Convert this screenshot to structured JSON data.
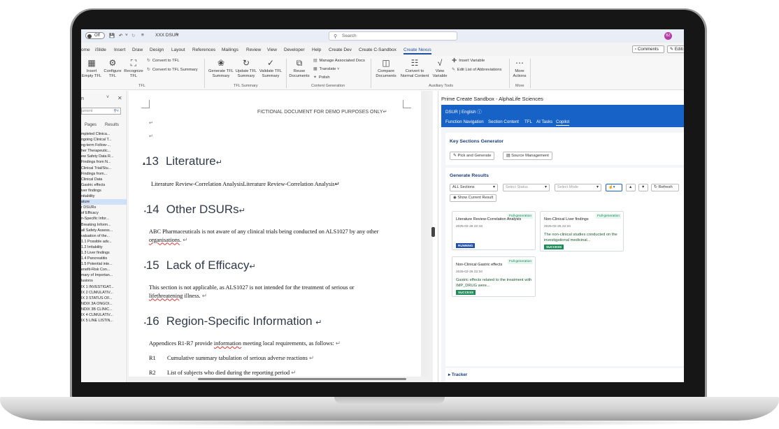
{
  "titlebar": {
    "autosave": "Off",
    "doc_name": "XXX DSUR",
    "search_placeholder": "Search",
    "avatar_initials": "BZ"
  },
  "menubar": {
    "items": [
      "ome",
      "iSlide",
      "Insert",
      "Draw",
      "Design",
      "Layout",
      "References",
      "Mailings",
      "Review",
      "View",
      "Developer",
      "Help",
      "Create Dev",
      "Create C-Sandbox",
      "Create Nexus"
    ],
    "comments": "Comments",
    "editing": "Editi"
  },
  "ribbon": {
    "insert_empty_tfl": "Insert Empty TFL",
    "configure_tfl": "Configure TFL",
    "recognize_tfl": "Recognize TFL",
    "convert_to_tfl": "Convert to TFL",
    "convert_to_tfl_summary": "Convert to TFL Summary",
    "group_tfl": "TFL",
    "generate_tfl_summary": "Generate TFL Summary",
    "update_tfl_summary": "Update TFL Summary",
    "validate_tfl_summary": "Validate TFL Summary",
    "group_tfl_summary": "TFL Summary",
    "reuse_documents": "Reuse Documents",
    "manage_associated_docs": "Manage Associated Docs",
    "translate": "Translate",
    "polish": "Polish",
    "group_content_generation": "Content Generation",
    "compare_documents": "Compare Documents",
    "convert_to_normal_content": "Convert to Normal Content",
    "view_variable": "View Variable",
    "insert_variable": "Insert Variable",
    "edit_list_abbreviations": "Edit List of Abbreviations",
    "group_auxiliary_tools": "Auxiliary Tools",
    "more_actions": "More Actions",
    "group_more": "More"
  },
  "nav": {
    "title": "n",
    "search_placeholder": "ument",
    "tabs": [
      "Pages",
      "Results"
    ],
    "items": [
      "mpleted Clinica...",
      "ngoing Clinical T...",
      "ng-term Follow-...",
      "her Therapeutic...",
      "ew Safety Data R...",
      "Findings from N...",
      "Clinical Trial/Stu...",
      "Findings from...",
      "Clinical Data",
      "Gastric effects",
      "iver findings",
      "nitability",
      "ature",
      "r DSURs",
      "of Efficacy",
      "n-Specific Infor...",
      "Breaking Inform...",
      "all Safety Assess...",
      "valuation of the...",
      "1.1 Possible adv...",
      "1.2 Irritability",
      "1.3 Liver findings",
      "1.4 Pancreatitis",
      "1.5 Potential inte...",
      "enefit-Risk Con...",
      "mary of Importan...",
      "lusions",
      "IX 1 INVESTIGAT...",
      "IX 2 CUMULATIV...",
      "IX 3 STATUS OF...",
      "NDIX 3A ONGOI...",
      "NDIX 3B CLINIC...",
      "IX 4 CUMULATIV...",
      "IX 5 LINE LISTIN..."
    ],
    "selected_index": 12
  },
  "document": {
    "header": "FICTIONAL DOCUMENT FOR DEMO PURPOSES ONLY",
    "para_mark": "↵",
    "s13_num": "13",
    "s13_title": "Literature",
    "s13_body": "Literature Review-Correlation AnalysisLiterature Review-Correlation Analysis",
    "s14_num": "14",
    "s14_title": "Other DSURs",
    "s14_body_a": "ABC Pharmaceuticals  is not aware of any clinical trials being conducted on  ALS1027  by any other ",
    "s14_body_u": "organisations",
    "s14_body_b": ".",
    "s15_num": "15",
    "s15_title": "Lack of Efficacy",
    "s15_body_a": "This section is not applicable, as  ALS1027  is not intended for the treatment of serious or ",
    "s15_body_u": "lifethreatening",
    "s15_body_b": " illness.",
    "s16_num": "16",
    "s16_title": "Region-Specific Information",
    "s16_body_a": "Appendices R1-R7 provide ",
    "s16_body_u": "information",
    "s16_body_b": " meeting local requirements, as follows:",
    "r1_code": "R1",
    "r1_text": "Cumulative summary tabulation of serious adverse reactions",
    "r2_code": "R2",
    "r2_text": "List of subjects who died during the reporting period"
  },
  "panel": {
    "title": "Prime Create Sandbox - AlphaLife Sciences",
    "top": "DSUR | English",
    "tabs": [
      "Function Navigation",
      "Section Content",
      "TFL",
      "AI Tasks",
      "Copilot"
    ],
    "active_tab": "Copilot",
    "key_sections": "Key Sections Generator",
    "pick_generate": "Pick and Generate",
    "source_management": "Source Management",
    "generate_results": "Generate Results",
    "filter_sections": "ALL Sections",
    "filter_status": "Select Status",
    "filter_mode": "Select Mode",
    "refresh": "Refresh",
    "show_current": "Show Current Result",
    "tracker": "Tracker",
    "results": [
      {
        "title": "Literature Review-Correlation Analysis",
        "tag": "Full-generation",
        "time": "2025-02-26 22:43",
        "text": "",
        "status": "RUNNING",
        "status_color": "#1f4fa8"
      },
      {
        "title": "Non-Clinical Liver findings",
        "tag": "Full-generation",
        "time": "2025-02-26 22:34",
        "text": "The non-clinical studies conducted on the investigational medicinal...",
        "status": "SUCCESS",
        "status_color": "#1e8a55"
      },
      {
        "title": "Non-Clinical Gastric effects",
        "tag": "Full-generation",
        "time": "2025-02-26 22:34",
        "text": "Gastric effects related to the treatment with IMP_DRUG were...",
        "status": "SUCCESS",
        "status_color": "#1e8a55"
      }
    ]
  }
}
